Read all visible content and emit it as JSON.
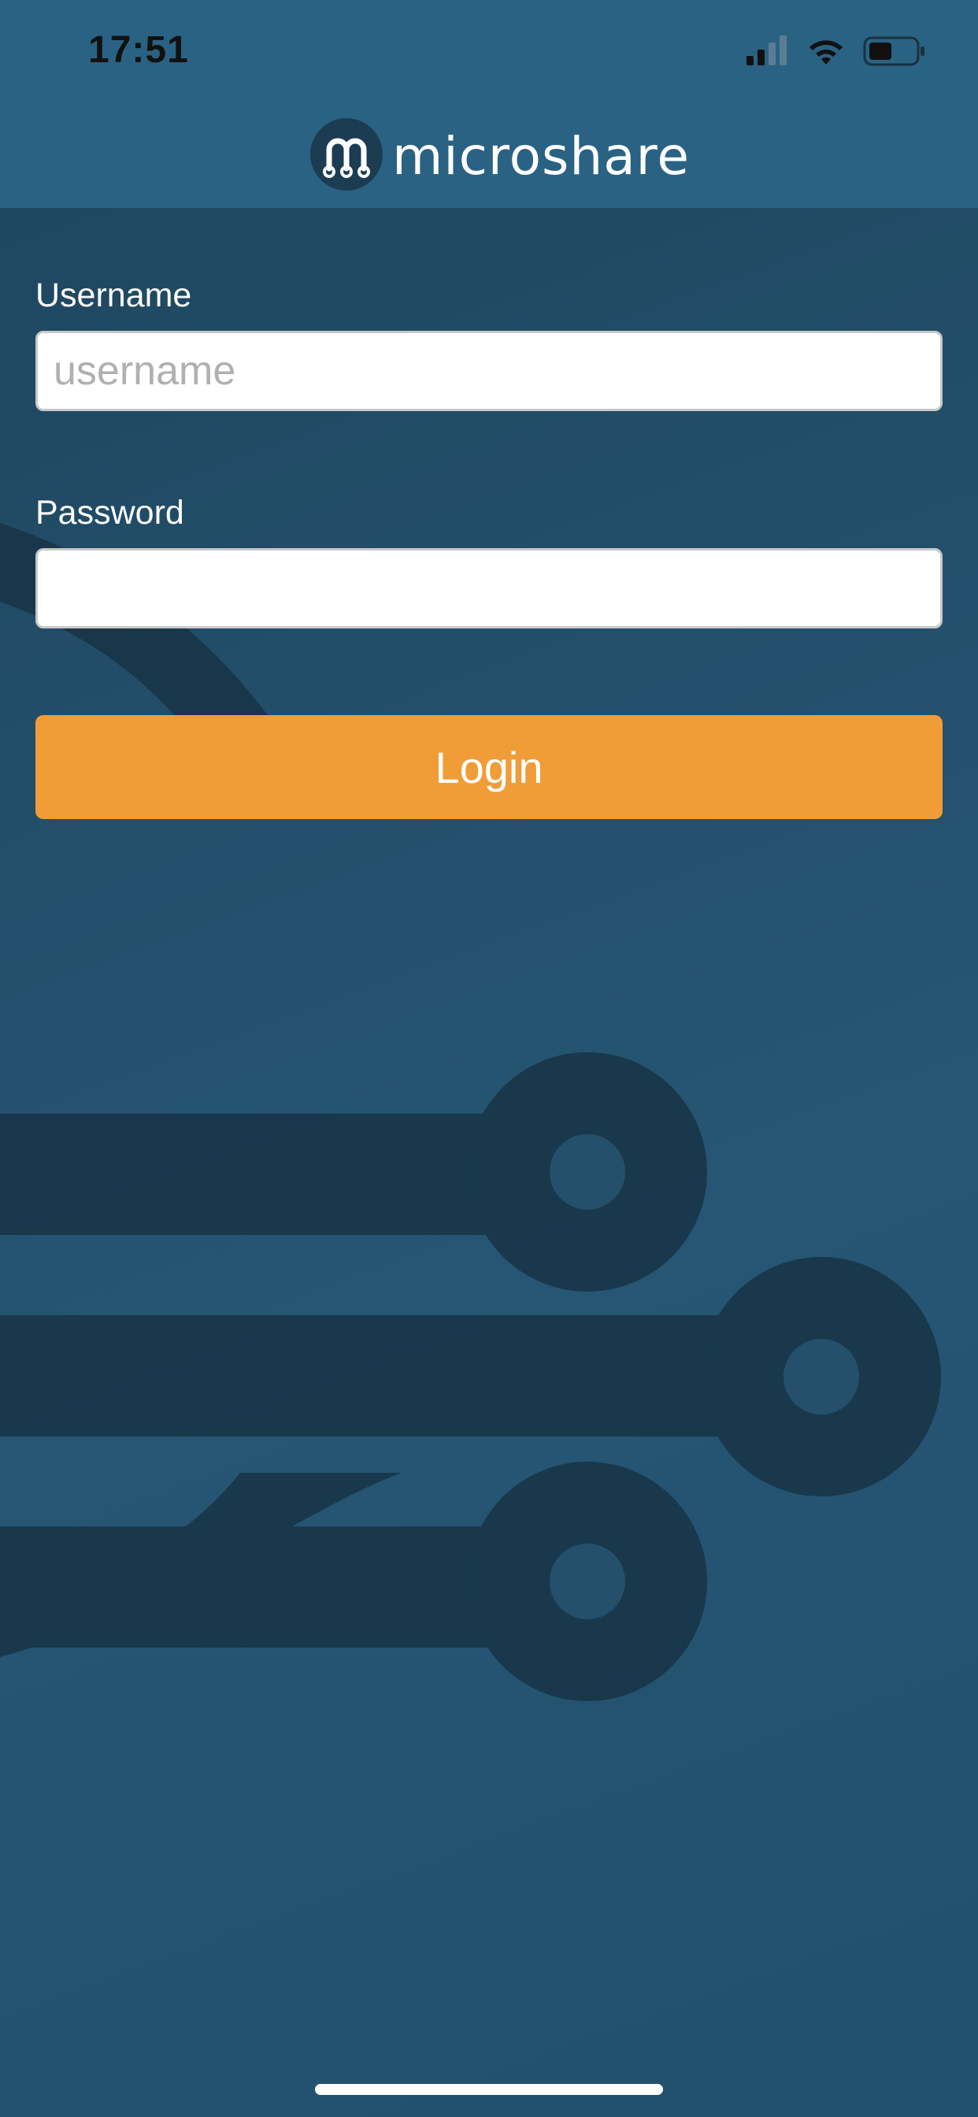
{
  "status_bar": {
    "time": "17:51",
    "icons": [
      "cellular-signal-icon",
      "wifi-icon",
      "battery-icon"
    ]
  },
  "header": {
    "logo_text": "microshare",
    "logo_icon": "microshare-logo-icon"
  },
  "form": {
    "username": {
      "label": "Username",
      "placeholder": "username",
      "value": ""
    },
    "password": {
      "label": "Password",
      "placeholder": "",
      "value": ""
    },
    "login_label": "Login"
  },
  "colors": {
    "header_bg": "#2a6283",
    "main_bg": "#214a63",
    "accent": "#f09d38",
    "text_light": "#ffffff"
  }
}
